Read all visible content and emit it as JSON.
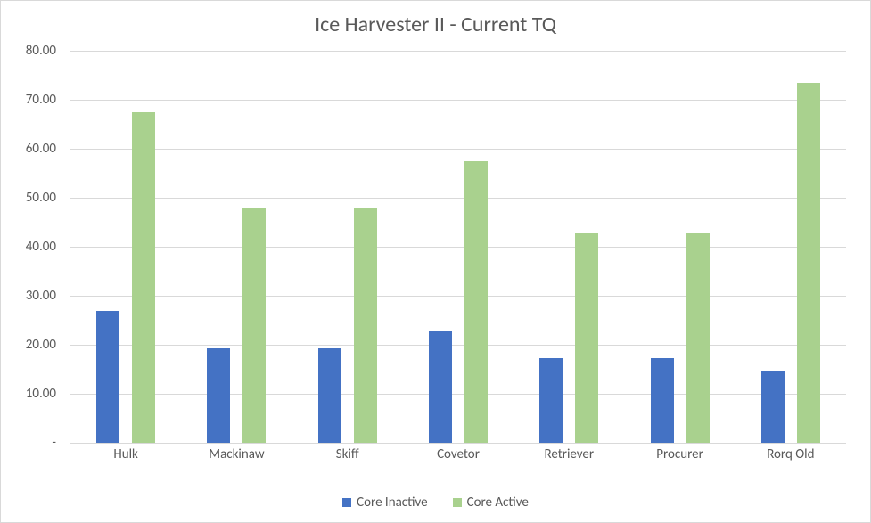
{
  "chart_data": {
    "type": "bar",
    "title": "Ice Harvester II - Current TQ",
    "xlabel": "",
    "ylabel": "",
    "ylim": [
      0,
      80
    ],
    "ytick_step": 10,
    "ytick_format": "fixed2_or_dash",
    "categories": [
      "Hulk",
      "Mackinaw",
      "Skiff",
      "Covetor",
      "Retriever",
      "Procurer",
      "Rorq Old"
    ],
    "series": [
      {
        "name": "Core Inactive",
        "color": "#4472C4",
        "values": [
          27.0,
          19.2,
          19.2,
          23.0,
          17.2,
          17.2,
          14.7
        ]
      },
      {
        "name": "Core Active",
        "color": "#A9D18E",
        "values": [
          67.5,
          47.8,
          47.8,
          57.5,
          43.0,
          43.0,
          73.4
        ]
      }
    ],
    "legend_position": "bottom",
    "grid": true
  }
}
